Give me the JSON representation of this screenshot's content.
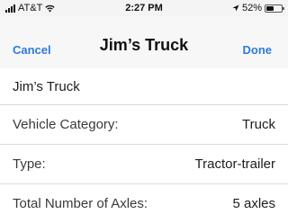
{
  "status_bar": {
    "carrier": "AT&T",
    "time": "2:27 PM",
    "battery_percent": "52%",
    "battery_level": 0.52,
    "signal_icon": "cellular-signal-icon",
    "wifi_icon": "wifi-icon",
    "location_icon": "location-arrow-icon"
  },
  "nav": {
    "cancel_label": "Cancel",
    "title": "Jim’s Truck",
    "done_label": "Done"
  },
  "name_field": {
    "value": "Jim’s Truck"
  },
  "rows": [
    {
      "label": "Vehicle Category:",
      "value": "Truck"
    },
    {
      "label": "Type:",
      "value": "Tractor-trailer"
    },
    {
      "label": "Total Number of Axles:",
      "value": "5 axles"
    }
  ],
  "colors": {
    "accent": "#2e7bd9",
    "background": "#efeff4"
  }
}
